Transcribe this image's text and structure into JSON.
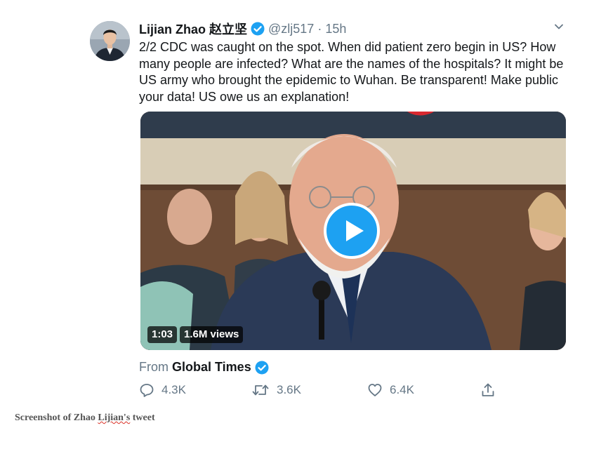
{
  "tweet": {
    "author_name": "Lijian Zhao 赵立坚",
    "handle": "@zlj517",
    "separator": "·",
    "time": "15h",
    "text": "2/2 CDC was caught on the spot. When did patient zero begin in US? How many people are infected? What are the names of the hospitals? It might be US army who brought the epidemic to Wuhan. Be transparent! Make public your data! US owe us an explanation!",
    "video": {
      "duration": "1:03",
      "views": "1.6M views"
    },
    "from_label": "From",
    "from_source": "Global Times",
    "actions": {
      "reply_count": "4.3K",
      "retweet_count": "3.6K",
      "like_count": "6.4K"
    }
  },
  "caption": {
    "before": "Screenshot of Zhao ",
    "underlined": "Lijian's",
    "after": " tweet"
  },
  "colors": {
    "accent": "#1da1f2",
    "secondary_text": "#657786",
    "primary_text": "#14171a"
  },
  "icons": [
    "verified-badge-icon",
    "chevron-down-icon",
    "play-icon",
    "reply-icon",
    "retweet-icon",
    "like-icon",
    "share-icon"
  ]
}
